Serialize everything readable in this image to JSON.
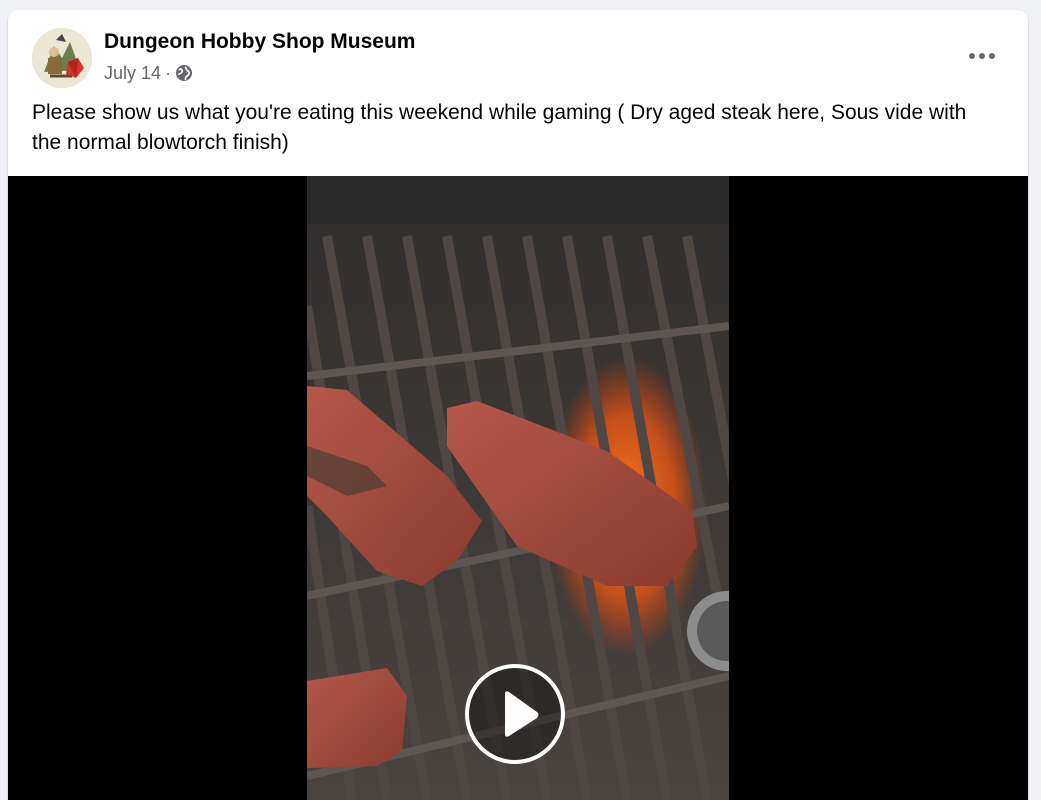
{
  "post": {
    "page_name": "Dungeon Hobby Shop Museum",
    "date": "July 14",
    "separator": "·",
    "privacy_icon": "globe-icon",
    "more_icon": "more-options-icon",
    "text": "Please show us what you're eating this weekend while gaming ( Dry aged steak here, Sous vide with the normal blowtorch finish)"
  },
  "video": {
    "play_icon": "play-icon",
    "subject": "steaks searing on a gas grill with flames"
  },
  "colors": {
    "page_background": "#f0f2f5",
    "card": "#ffffff",
    "primary_text": "#050505",
    "secondary_text": "#65676b",
    "video_background": "#000000"
  }
}
